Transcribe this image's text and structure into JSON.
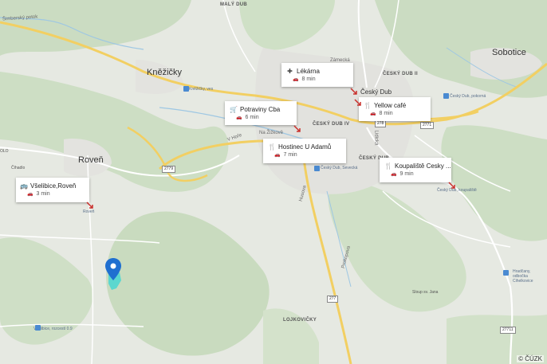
{
  "map": {
    "attribution": "© ČÚZK"
  },
  "places": {
    "maly_dub": "MALÝ DUB",
    "knezicky": "Kněžičky",
    "sobotice": "Sobotice",
    "ceskydub": "Český Dub",
    "ceskydub_ii": "ČESKÝ DUB II",
    "ceskydub_iv": "ČESKÝ DUB IV",
    "ceskydub_v": "ČESKÝ DUB",
    "roven": "Roveň",
    "lojkovicky": "LOJKOVIČKY",
    "simbersky_potok": "Šimberský potok",
    "zamecka": "Zámecká",
    "na_zizkove": "Na Žižkově",
    "v_hore": "V Hoře",
    "husova": "Husova",
    "liduska": "Lidická",
    "prokopova": "Prokopova",
    "prostredni": "Prostřední",
    "vselibice_label": "Všelibice, rozcestí 0.9",
    "roven_small": "Roveň",
    "knezicky_ves": "Kněžičky, ves",
    "ceskydub_sev": "Český Dub, Sevecká",
    "ceskydub_koupaliste": "Český Dub, koupaliště",
    "ceskydub_pokorna": "Český Dub, pokorná",
    "hradcany": "Hradčany, odbočka Cihelkovice",
    "slup": "Sloup sv. Jana",
    "olo": "OLO",
    "cihadlo": "Číhadlo"
  },
  "roads": {
    "r2779": "2779",
    "r277": "277",
    "r2771a": "2771",
    "r2771b": "27711",
    "r278": "278"
  },
  "cards": [
    {
      "name": "Lékárna",
      "time": "8 min",
      "icon": "pharmacy-icon"
    },
    {
      "name": "Potraviny Cba",
      "time": "6 min",
      "icon": "grocery-cart-icon"
    },
    {
      "name": "Yellow café",
      "time": "8 min",
      "icon": "restaurant-icon"
    },
    {
      "name": "Hostinec U Adamů",
      "time": "7 min",
      "icon": "restaurant-icon"
    },
    {
      "name": "Koupaliště Cesky ...",
      "time": "9 min",
      "icon": "restaurant-icon"
    },
    {
      "name": "Všelibice,Roveň",
      "time": "3 min",
      "icon": "bus-icon"
    }
  ],
  "colors": {
    "forest": "#c8dbbf",
    "land": "#e8ebe5",
    "road_major": "#f5d56a",
    "road_minor": "#ffffff",
    "water": "#9ec7e3",
    "marker": "#1f6fd0",
    "marker_area": "#4fd6d0"
  }
}
